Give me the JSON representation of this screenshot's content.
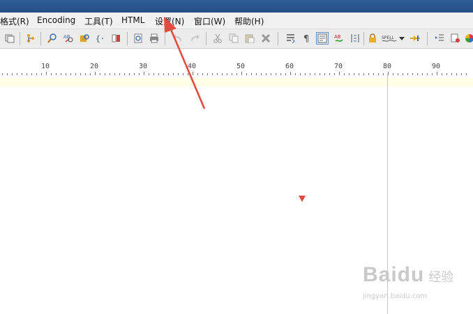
{
  "menu": {
    "items": [
      {
        "label": "格式(R)"
      },
      {
        "label": "Encoding"
      },
      {
        "label": "工具(T)"
      },
      {
        "label": "HTML"
      },
      {
        "label": "设置(N)"
      },
      {
        "label": "窗口(W)"
      },
      {
        "label": "帮助(H)"
      }
    ]
  },
  "toolbar": {
    "icons": [
      "window-icon",
      "tree-icon",
      "find-icon",
      "replace-icon",
      "find-in-files-icon",
      "braces-icon",
      "bookmark-icon",
      "print-preview-icon",
      "print-icon",
      "undo-icon",
      "redo-icon",
      "cut-icon",
      "copy-icon",
      "paste-icon",
      "delete-icon",
      "word-wrap-icon",
      "pilcrow-icon",
      "text-view-icon",
      "spell-check-icon",
      "column-icon",
      "lock-icon",
      "spell-label-icon",
      "dropdown-icon",
      "toggle-icon",
      "indent-icon",
      "settings-icon",
      "color-icon"
    ],
    "spell_label": "SPELL"
  },
  "ruler": {
    "labels": [
      "10",
      "20",
      "30",
      "40",
      "50",
      "60",
      "70",
      "80",
      "90"
    ]
  },
  "watermark": {
    "brand": "Baidu",
    "cn": "经验",
    "url": "jingyan.baidu.com"
  },
  "colors": {
    "annotation": "#e54b3f",
    "current_line": "#ffffe6",
    "titlebar": "#2f5f98"
  }
}
